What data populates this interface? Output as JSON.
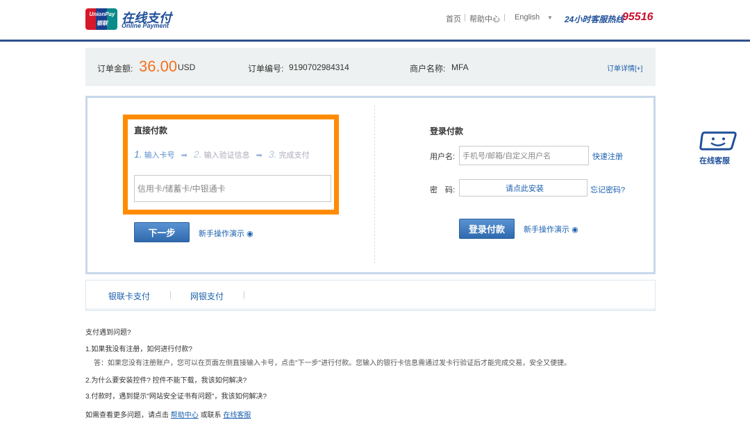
{
  "header": {
    "logo_text": "UnionPay 银联",
    "brand_cn": "在线支付",
    "brand_en": "Online Payment",
    "nav": [
      "首页",
      "帮助中心",
      "English"
    ],
    "hotline_label": "24小时客服热线",
    "hotline_number": "95516"
  },
  "order": {
    "amount_label": "订单金额:",
    "amount": "36.00",
    "currency": "USD",
    "order_no_label": "订单编号:",
    "order_no": "9190702984314",
    "merchant_label": "商户名称:",
    "merchant": "MFA",
    "details_link": "订单详情[+]"
  },
  "direct": {
    "title": "直接付款",
    "steps": [
      "1.",
      "输入卡号",
      "2.",
      "输入验证信息",
      "3.",
      "完成支付"
    ],
    "card_placeholder": "信用卡/储蓄卡/中银通卡",
    "next_button": "下一步",
    "demo_link": "新手操作演示"
  },
  "login": {
    "title": "登录付款",
    "username_label": "用户名:",
    "username_placeholder": "手机号/邮箱/自定义用户名",
    "register_link": "快速注册",
    "password_label": "密　码:",
    "install_link": "请点此安装",
    "forgot_link": "忘记密码?",
    "login_button": "登录付款",
    "demo_link": "新手操作演示"
  },
  "tabs": [
    "银联卡支付",
    "网银支付"
  ],
  "support": {
    "label": "在线客服"
  },
  "faq": {
    "title": "支付遇到问题?",
    "q1": "1.如果我没有注册，如何进行付款?",
    "a1": "答：如果您没有注册账户，您可以在页面左侧直接输入卡号，点击\"下一步\"进行付款。您输入的银行卡信息需通过发卡行验证后才能完成交易，安全又便捷。",
    "q2": "2.为什么要安装控件? 控件不能下载，我该如何解决?",
    "q3": "3.付款时，遇到提示\"网站安全证书有问题\"，我该如何解决?",
    "more_prefix": "如需查看更多问题，请点击",
    "help_link": "帮助中心",
    "or_text": "或联系",
    "service_link": "在线客服"
  }
}
